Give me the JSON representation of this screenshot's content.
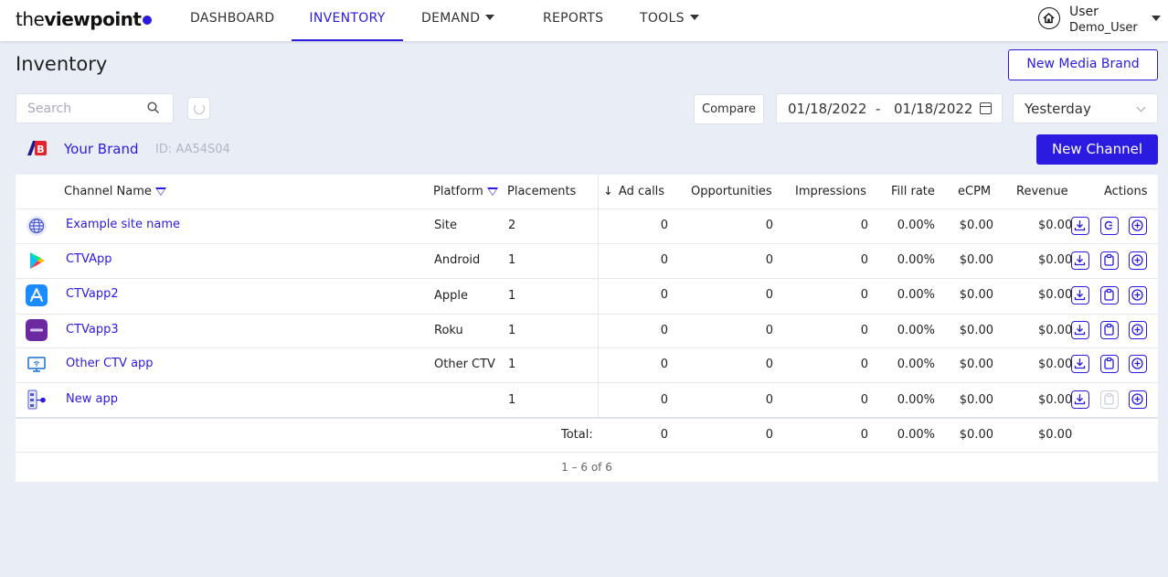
{
  "nav": {
    "logo_thin": "the",
    "logo_bold": "viewpoint",
    "items": [
      {
        "label": "DASHBOARD"
      },
      {
        "label": "INVENTORY"
      },
      {
        "label": "DEMAND"
      },
      {
        "label": "REPORTS"
      },
      {
        "label": "TOOLS"
      }
    ],
    "user": {
      "label": "User",
      "name": "Demo_User"
    }
  },
  "header": {
    "title": "Inventory",
    "new_media_brand": "New Media Brand",
    "search_placeholder": "Search",
    "compare": "Compare",
    "date_from": "01/18/2022",
    "date_sep": "-",
    "date_to": "01/18/2022",
    "preset": "Yesterday"
  },
  "brand": {
    "name": "Your Brand",
    "id": "ID: AA54S04",
    "new_channel": "New Channel"
  },
  "table": {
    "columns": [
      "Channel Name",
      "Platform",
      "Placements",
      "Ad calls",
      "Opportunities",
      "Impressions",
      "Fill rate",
      "eCPM",
      "Revenue",
      "Actions"
    ],
    "rows": [
      {
        "icon": "globe-icon",
        "name": "Example site name",
        "platform": "Site",
        "placements": "2",
        "ad_calls": "0",
        "opportunities": "0",
        "impressions": "0",
        "fill_rate": "0.00%",
        "ecpm": "$0.00",
        "revenue": "$0.00",
        "second_action": "copy-icon",
        "second_enabled": true
      },
      {
        "icon": "google-play-icon",
        "name": "CTVApp",
        "platform": "Android",
        "placements": "1",
        "ad_calls": "0",
        "opportunities": "0",
        "impressions": "0",
        "fill_rate": "0.00%",
        "ecpm": "$0.00",
        "revenue": "$0.00",
        "second_action": "clipboard-icon",
        "second_enabled": true
      },
      {
        "icon": "app-store-icon",
        "name": "CTVapp2",
        "platform": "Apple",
        "placements": "1",
        "ad_calls": "0",
        "opportunities": "0",
        "impressions": "0",
        "fill_rate": "0.00%",
        "ecpm": "$0.00",
        "revenue": "$0.00",
        "second_action": "clipboard-icon",
        "second_enabled": true
      },
      {
        "icon": "roku-icon",
        "name": "CTVapp3",
        "platform": "Roku",
        "placements": "1",
        "ad_calls": "0",
        "opportunities": "0",
        "impressions": "0",
        "fill_rate": "0.00%",
        "ecpm": "$0.00",
        "revenue": "$0.00",
        "second_action": "clipboard-icon",
        "second_enabled": true
      },
      {
        "icon": "tv-wifi-icon",
        "name": "Other CTV app",
        "platform": "Other CTV",
        "placements": "1",
        "ad_calls": "0",
        "opportunities": "0",
        "impressions": "0",
        "fill_rate": "0.00%",
        "ecpm": "$0.00",
        "revenue": "$0.00",
        "second_action": "clipboard-icon",
        "second_enabled": true
      },
      {
        "icon": "app-tree-icon",
        "name": "New app",
        "platform": "",
        "placements": "1",
        "ad_calls": "0",
        "opportunities": "0",
        "impressions": "0",
        "fill_rate": "0.00%",
        "ecpm": "$0.00",
        "revenue": "$0.00",
        "second_action": "clipboard-icon",
        "second_enabled": false
      }
    ],
    "total": {
      "label": "Total:",
      "ad_calls": "0",
      "opportunities": "0",
      "impressions": "0",
      "fill_rate": "0.00%",
      "ecpm": "$0.00",
      "revenue": "$0.00"
    },
    "pagination": "1 – 6 of 6"
  },
  "colors": {
    "accent": "#2b1ae0",
    "background": "#e9edf5"
  }
}
